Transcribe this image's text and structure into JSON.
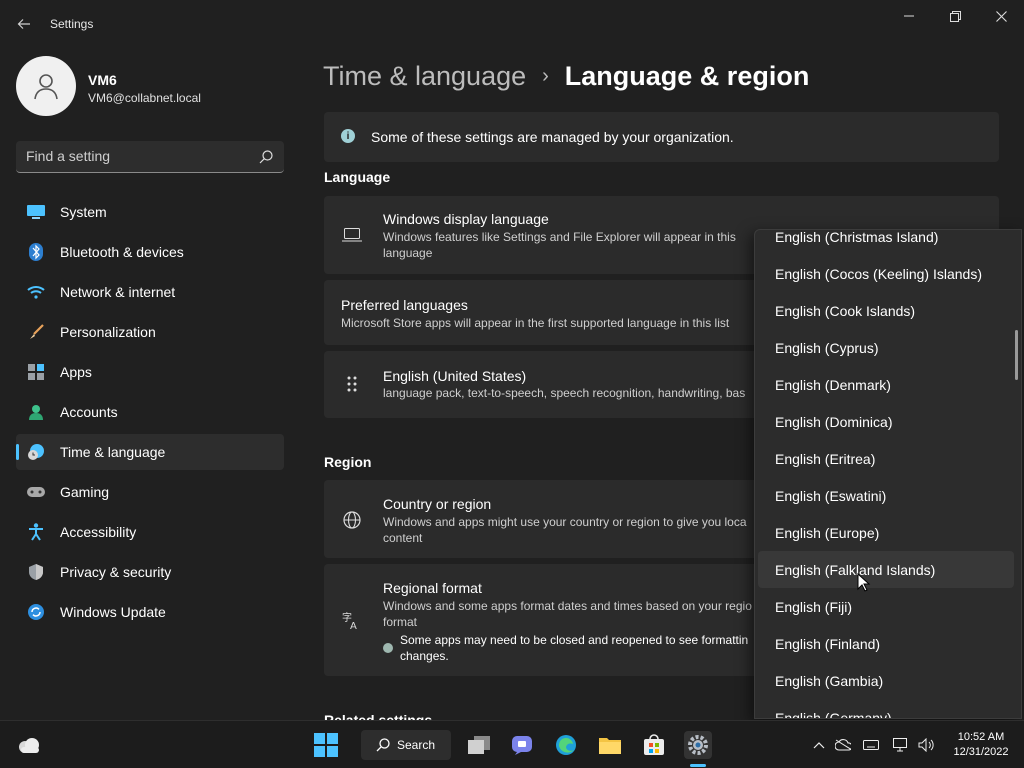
{
  "window": {
    "title": "Settings",
    "controls": {
      "minimize": "minimize",
      "maximize": "maximize",
      "close": "close"
    }
  },
  "profile": {
    "name": "VM6",
    "email": "VM6@collabnet.local"
  },
  "search": {
    "placeholder": "Find a setting"
  },
  "sidebar": {
    "items": [
      {
        "label": "System",
        "icon": "system-icon",
        "active": false
      },
      {
        "label": "Bluetooth & devices",
        "icon": "bluetooth-icon",
        "active": false
      },
      {
        "label": "Network & internet",
        "icon": "network-icon",
        "active": false
      },
      {
        "label": "Personalization",
        "icon": "brush-icon",
        "active": false
      },
      {
        "label": "Apps",
        "icon": "apps-icon",
        "active": false
      },
      {
        "label": "Accounts",
        "icon": "accounts-icon",
        "active": false
      },
      {
        "label": "Time & language",
        "icon": "time-language-icon",
        "active": true
      },
      {
        "label": "Gaming",
        "icon": "gaming-icon",
        "active": false
      },
      {
        "label": "Accessibility",
        "icon": "accessibility-icon",
        "active": false
      },
      {
        "label": "Privacy & security",
        "icon": "shield-icon",
        "active": false
      },
      {
        "label": "Windows Update",
        "icon": "update-icon",
        "active": false
      }
    ]
  },
  "breadcrumb": {
    "parent": "Time & language",
    "separator": "›",
    "current": "Language & region"
  },
  "org_banner": {
    "text": "Some of these settings are managed by your organization."
  },
  "language": {
    "heading": "Language",
    "display_language": {
      "title": "Windows display language",
      "subtitle": "Windows features like Settings and File Explorer will appear in this language"
    },
    "preferred": {
      "title": "Preferred languages",
      "subtitle": "Microsoft Store apps will appear in the first supported language in this list"
    },
    "english_us": {
      "title": "English (United States)",
      "subtitle": "language pack, text-to-speech, speech recognition, handwriting, bas"
    }
  },
  "region": {
    "heading": "Region",
    "country": {
      "title": "Country or region",
      "subtitle": "Windows and apps might use your country or region to give you loca content"
    },
    "format": {
      "title": "Regional format",
      "subtitle": "Windows and some apps format dates and times based on your regio format",
      "note": "Some apps may need to be closed and reopened to see formattin changes."
    }
  },
  "related": {
    "heading": "Related settings"
  },
  "dropdown": {
    "items": [
      "English (Christmas Island)",
      "English (Cocos (Keeling) Islands)",
      "English (Cook Islands)",
      "English (Cyprus)",
      "English (Denmark)",
      "English (Dominica)",
      "English (Eritrea)",
      "English (Eswatini)",
      "English (Europe)",
      "English (Falkland Islands)",
      "English (Fiji)",
      "English (Finland)",
      "English (Gambia)",
      "English (Germany)"
    ],
    "hovered": "English (Falkland Islands)"
  },
  "taskbar": {
    "search_label": "Search",
    "time": "10:52 AM",
    "date": "12/31/2022",
    "apps": [
      "file-explorer-icon",
      "teams-chat-icon",
      "edge-icon",
      "folder-icon",
      "store-icon",
      "settings-icon"
    ],
    "active_app": "settings-icon"
  },
  "colors": {
    "accent": "#4cc2ff",
    "background": "#202020",
    "card": "#2b2b2b"
  }
}
